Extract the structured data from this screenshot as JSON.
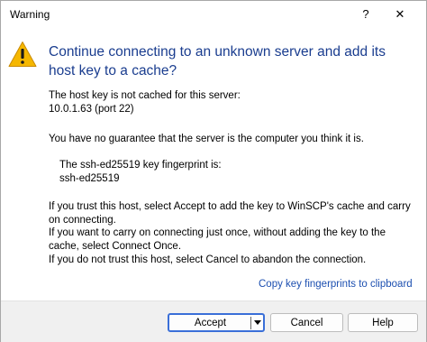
{
  "window": {
    "title": "Warning",
    "help_glyph": "?",
    "close_glyph": "✕"
  },
  "icon": "warning-triangle-icon",
  "heading": "Continue connecting to an unknown server and add its host key to a cache?",
  "body": {
    "line1": "The host key is not cached for this server:",
    "line2": "10.0.1.63 (port 22)",
    "line3": "You have no guarantee that the server is the computer you think it is.",
    "fingerprint_label": "The ssh-ed25519 key fingerprint is:",
    "fingerprint_value": "ssh-ed25519",
    "p1": "If you trust this host, select Accept to add the key to WinSCP's cache and carry",
    "p2": "on connecting.",
    "p3": "If you want to carry on connecting just once, without adding the key to the",
    "p4": "cache, select Connect Once.",
    "p5": "If you do not trust this host, select Cancel to abandon the connection."
  },
  "link": "Copy key fingerprints to clipboard",
  "buttons": {
    "accept": "Accept",
    "cancel": "Cancel",
    "help": "Help"
  },
  "colors": {
    "heading": "#1a3d8f",
    "link": "#1c4fb0",
    "default_button_border": "#3a6fd8",
    "warning_fill": "#f5b700"
  }
}
